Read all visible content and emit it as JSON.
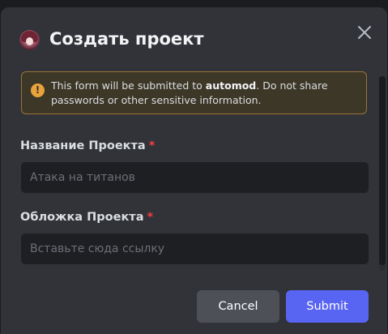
{
  "modal": {
    "title": "Создать проект",
    "close_icon": "close-icon",
    "avatar_icon": "avatar"
  },
  "notice": {
    "icon": "warning-icon",
    "text_prefix": "This form will be submitted to ",
    "app_name": "automod",
    "text_suffix": ". Do not share passwords or other sensitive information."
  },
  "fields": [
    {
      "label": "Название Проекта",
      "required_mark": "*",
      "placeholder": "Атака на титанов",
      "value": ""
    },
    {
      "label": "Обложка Проекта",
      "required_mark": "*",
      "placeholder": "Вставьте сюда ссылку",
      "value": ""
    }
  ],
  "buttons": {
    "cancel_label": "Cancel",
    "submit_label": "Submit"
  },
  "colors": {
    "accent": "#5865f2",
    "warning": "#e9a33a",
    "required": "#f23f43",
    "background": "#313338"
  }
}
